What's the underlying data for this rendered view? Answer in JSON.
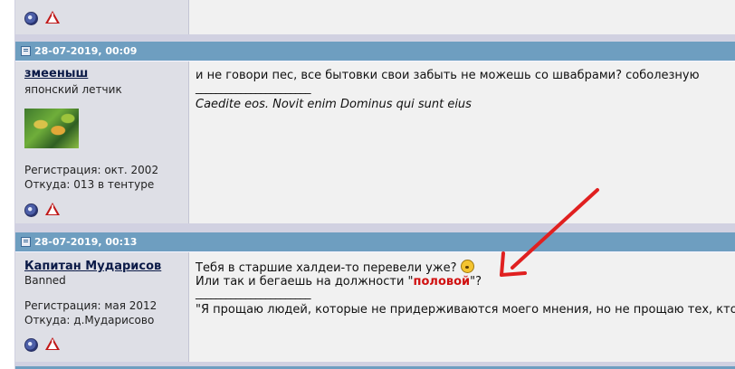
{
  "posts": [
    {
      "date": "28-07-2019, 00:09",
      "username": "змееныш",
      "user_title": "японский летчик",
      "registration": "Регистрация: окт. 2002",
      "location": "Откуда: 013 в тентуре",
      "message_line1": "и не говори пес, все бытовки свои забыть не можешь со швабрами? соболезную",
      "signature_sep": "_______________________",
      "signature": "Caedite eos. Novit enim Dominus qui sunt eius"
    },
    {
      "date": "28-07-2019, 00:13",
      "username": "Капитан Мударисов",
      "user_title": "Banned",
      "registration": "Регистрация: мая 2012",
      "location": "Откуда: д.Мударисово",
      "message_line1": "Тебя в старшие халдеи-то перевели уже?",
      "message_line2_a": "Или так и бегаешь на должности \"",
      "message_line2_b": "половой",
      "message_line2_c": "\"?",
      "signature_sep": "_______________________",
      "signature": "\"Я прощаю людей, которые не придерживаются моего мнения, но не прощаю тех, кто"
    }
  ],
  "icons": [
    "online-status-icon",
    "report-post-icon",
    "post-icon",
    "smiley-icon",
    "annotation-arrow"
  ],
  "colors": {
    "header": "#6e9ec0",
    "annotation": "#e02020",
    "highlight": "#d01010"
  }
}
